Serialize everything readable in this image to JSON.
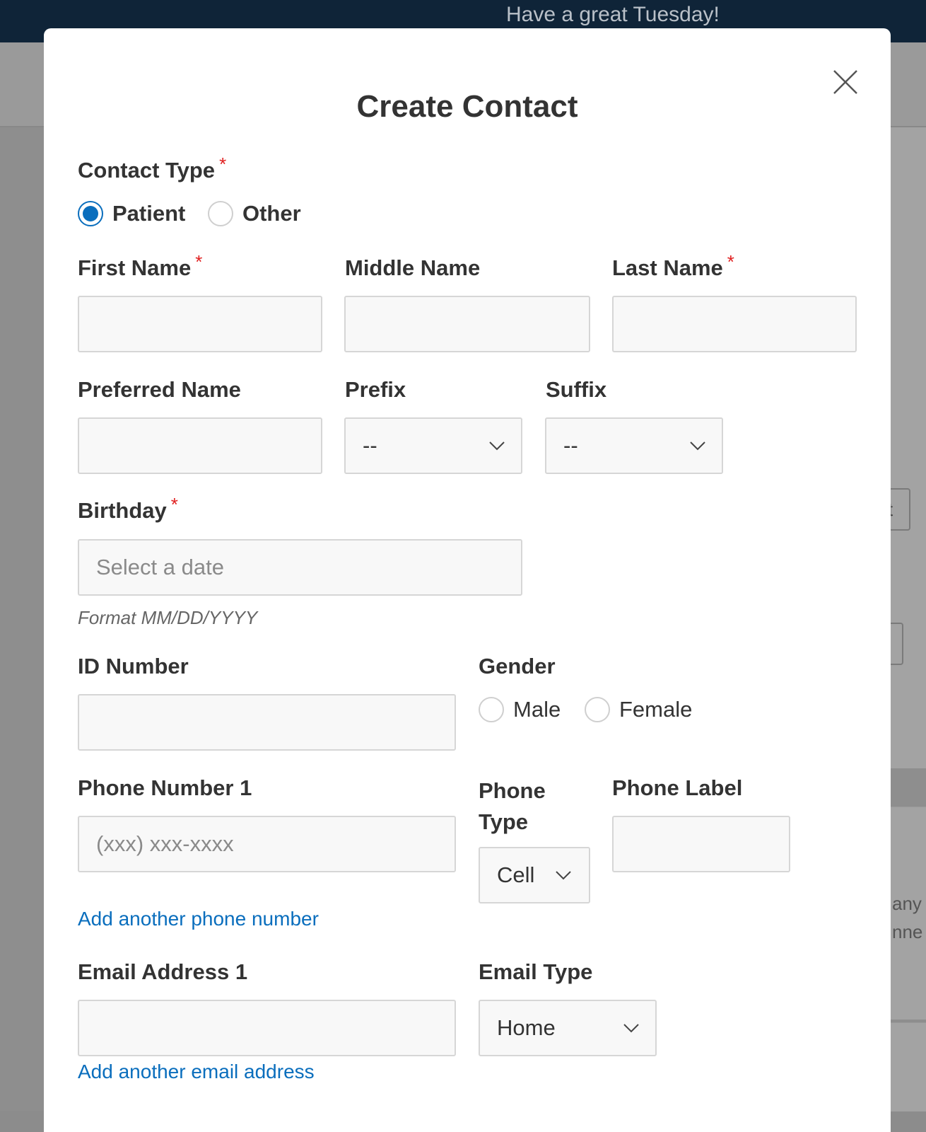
{
  "app": {
    "greeting": "Have a great Tuesday!",
    "background_fragments": {
      "button_text": "t",
      "text_line_1": "any",
      "text_line_2": "nne"
    }
  },
  "modal": {
    "title": "Create Contact",
    "close_icon": "close-icon",
    "required_mark": "*",
    "contact_type": {
      "label": "Contact Type",
      "options": [
        {
          "label": "Patient",
          "selected": true
        },
        {
          "label": "Other",
          "selected": false
        }
      ]
    },
    "first_name": {
      "label": "First Name",
      "value": ""
    },
    "middle_name": {
      "label": "Middle Name",
      "value": ""
    },
    "last_name": {
      "label": "Last Name",
      "value": ""
    },
    "preferred_name": {
      "label": "Preferred Name",
      "value": ""
    },
    "prefix": {
      "label": "Prefix",
      "selected": "--"
    },
    "suffix": {
      "label": "Suffix",
      "selected": "--"
    },
    "birthday": {
      "label": "Birthday",
      "placeholder": "Select a date",
      "value": "",
      "hint": "Format MM/DD/YYYY"
    },
    "id_number": {
      "label": "ID Number",
      "value": ""
    },
    "gender": {
      "label": "Gender",
      "options": [
        {
          "label": "Male",
          "selected": false
        },
        {
          "label": "Female",
          "selected": false
        }
      ]
    },
    "phone_number": {
      "label": "Phone Number 1",
      "placeholder": "(xxx) xxx-xxxx",
      "value": ""
    },
    "phone_type": {
      "label_line1": "Phone",
      "label_line2": "Type",
      "selected": "Cell"
    },
    "phone_label": {
      "label": "Phone Label",
      "value": ""
    },
    "add_phone_link": "Add another phone number",
    "email_address": {
      "label": "Email Address 1",
      "value": ""
    },
    "email_type": {
      "label": "Email Type",
      "selected": "Home"
    },
    "add_email_link": "Add another email address"
  },
  "colors": {
    "accent": "#0a6ebd",
    "required": "#e02020",
    "topbar": "#0f2438"
  }
}
